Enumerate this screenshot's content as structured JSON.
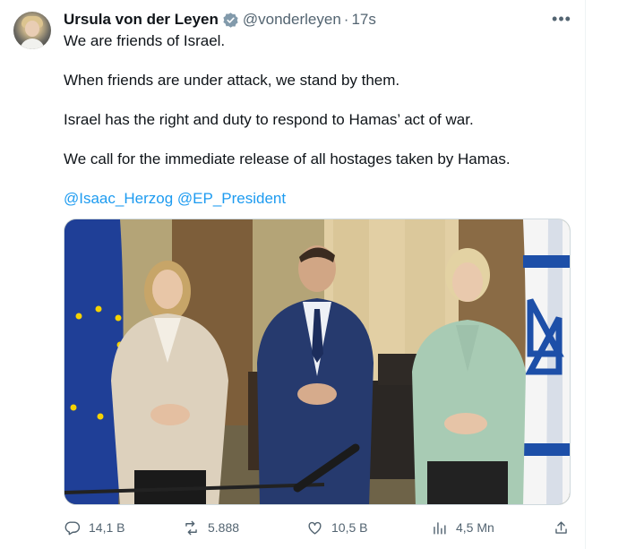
{
  "tweet": {
    "author_name": "Ursula von der Leyen",
    "handle": "@vonderleyen",
    "separator": "·",
    "time": "17s",
    "more_label": "•••",
    "lines": [
      "We are friends of Israel.",
      "When friends are under attack, we stand by them.",
      "Israel has the right and duty to respond to Hamas’ act of war.",
      "We call for the immediate release of all hostages taken by Hamas."
    ],
    "mentions": [
      "@Isaac_Herzog",
      "@EP_President"
    ]
  },
  "actions": {
    "replies": "14,1 B",
    "reposts": "5.888",
    "likes": "10,5 B",
    "views": "4,5 Mn"
  },
  "icons": {
    "verified": "verified-badge-icon",
    "reply": "reply-icon",
    "repost": "repost-icon",
    "like": "heart-icon",
    "views": "views-chart-icon",
    "share": "share-icon"
  },
  "colors": {
    "accent": "#1d9bf0",
    "secondary_text": "#536471",
    "eu_flag": "#1f3f97",
    "eu_star": "#f5d200",
    "israel_blue": "#1d4fa8"
  }
}
